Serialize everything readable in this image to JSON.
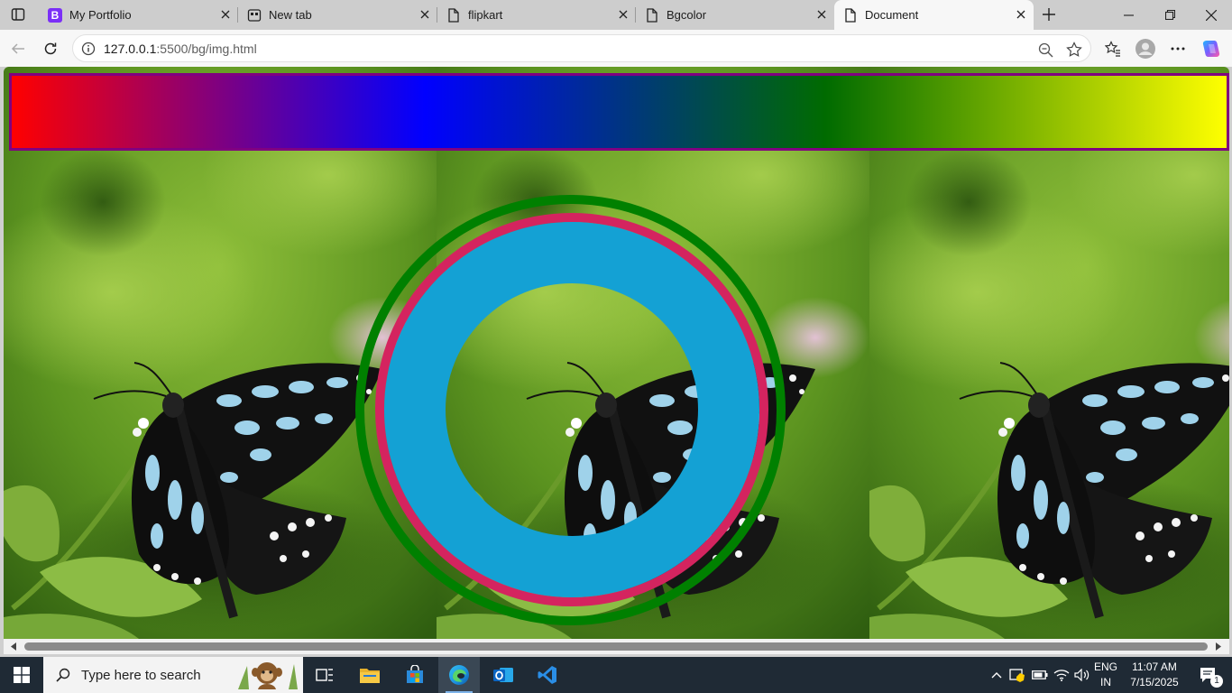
{
  "browser": {
    "tabs": [
      {
        "label": "My Portfolio",
        "icon": "bootstrap-icon"
      },
      {
        "label": "New tab",
        "icon": "new-tab-icon"
      },
      {
        "label": "flipkart",
        "icon": "page-icon"
      },
      {
        "label": "Bgcolor",
        "icon": "page-icon"
      },
      {
        "label": "Document",
        "icon": "page-icon",
        "active": true
      }
    ],
    "address_bar": {
      "url_host": "127.0.0.1",
      "url_rest": ":5500/bg/img.html"
    }
  },
  "page": {
    "gradient_colors": [
      "#ff0000",
      "blue",
      "#006b00",
      "#ffff00"
    ],
    "gradient_border": "purple",
    "rings": {
      "outer": "#008000",
      "middle": "#d4245f",
      "inner": "#14a1d4"
    }
  },
  "taskbar": {
    "search_placeholder": "Type here to search",
    "language": "ENG",
    "region": "IN",
    "time": "11:07 AM",
    "date": "7/15/2025",
    "notification_count": "1"
  }
}
